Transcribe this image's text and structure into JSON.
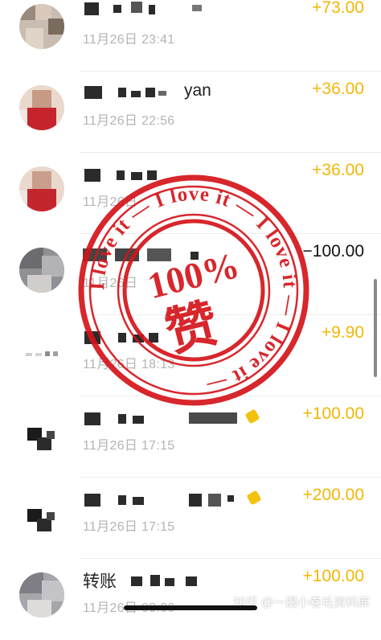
{
  "theme": {
    "amount_positive_color": "#f2b705",
    "amount_negative_color": "#111111",
    "date_color": "#b4b4b4",
    "stamp_color": "#d4151b"
  },
  "transactions": [
    {
      "name": "",
      "date": "11月26日 23:41",
      "amount": "+73.00",
      "direction": "in",
      "avatar": "avatar-icon"
    },
    {
      "name": "yan",
      "date": "11月26日 22:56",
      "amount": "+36.00",
      "direction": "in",
      "avatar": "avatar-icon"
    },
    {
      "name": "",
      "date": "11月26日",
      "amount": "+36.00",
      "direction": "in",
      "avatar": "avatar-icon"
    },
    {
      "name": "",
      "date": "11月26日",
      "amount": "−100.00",
      "direction": "out",
      "avatar": "avatar-icon"
    },
    {
      "name": "",
      "date": "11月26日 18:13",
      "amount": "+9.90",
      "direction": "in",
      "avatar": "avatar-icon"
    },
    {
      "name": "",
      "date": "11月26日 17:15",
      "amount": "+100.00",
      "direction": "in",
      "avatar": "avatar-icon"
    },
    {
      "name": "",
      "date": "11月26日 17:15",
      "amount": "+200.00",
      "direction": "in",
      "avatar": "avatar-icon"
    },
    {
      "name": "转账",
      "date": "11月26日 00:06",
      "amount": "+100.00",
      "direction": "in",
      "avatar": "avatar-icon"
    }
  ],
  "stamp": {
    "ring_text": "I love it — I love it — I love it — I love it —",
    "center_percent": "100%",
    "center_char": "赞",
    "icon": "approval-stamp-icon"
  },
  "watermark": {
    "text": "知乎 @一撮小卷毛资料库"
  }
}
